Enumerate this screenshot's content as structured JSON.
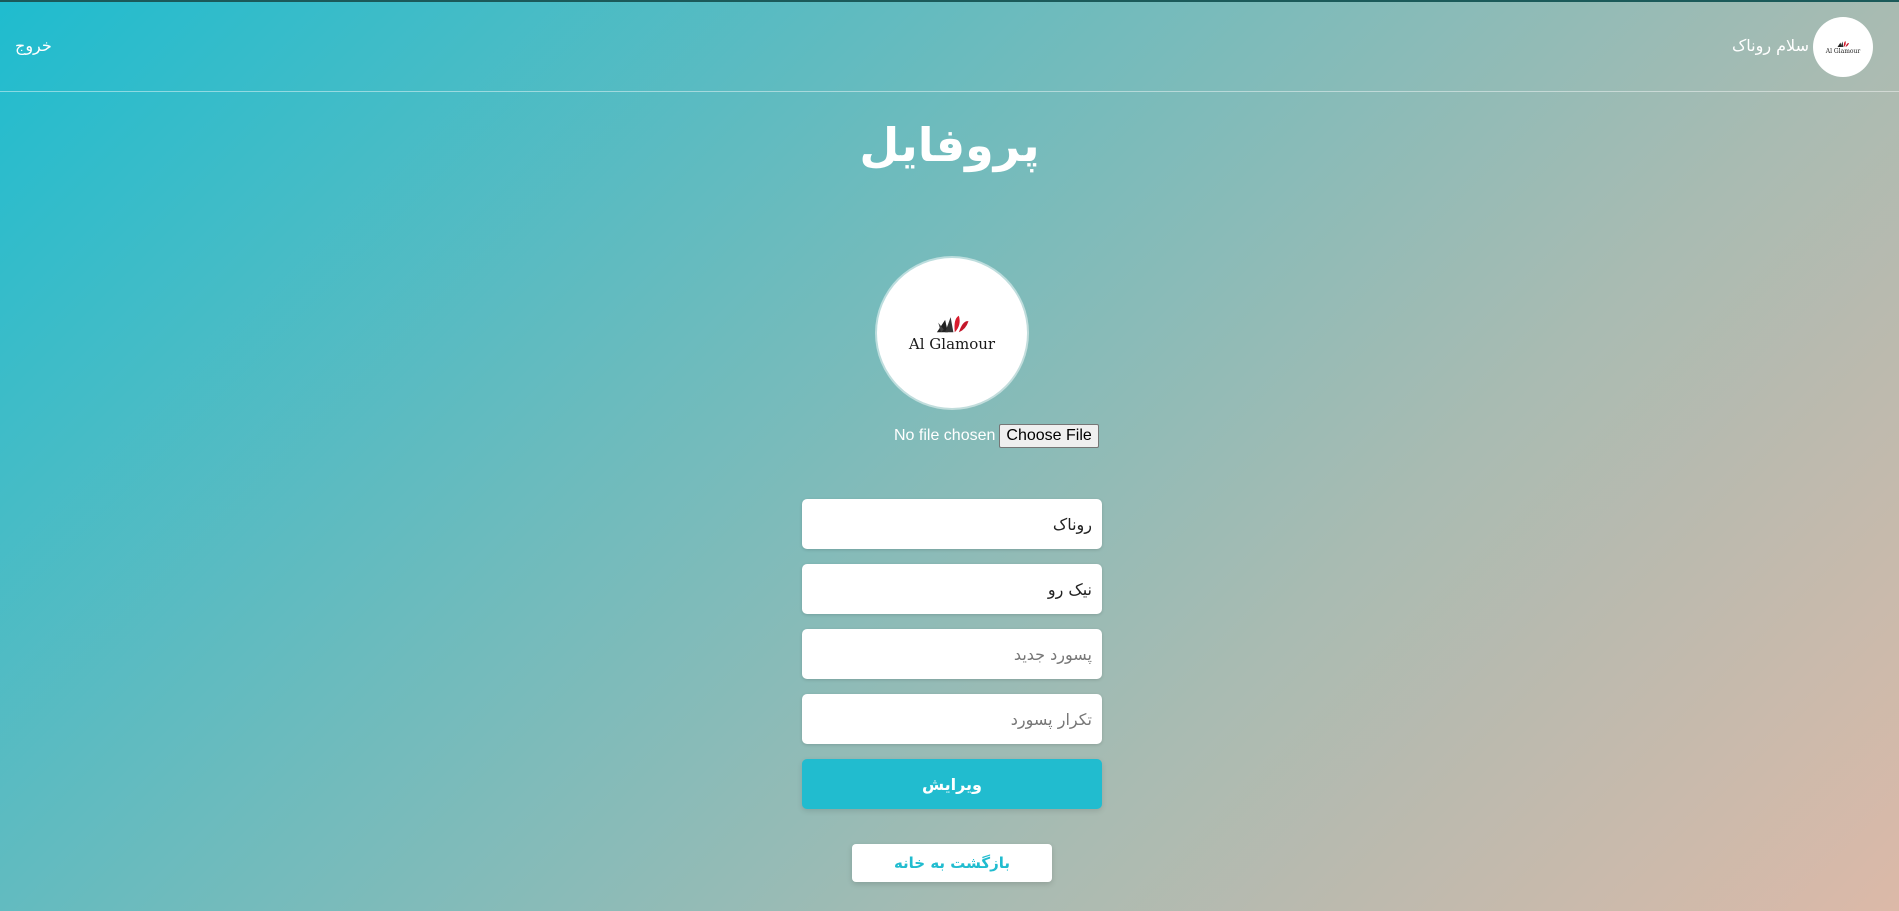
{
  "header": {
    "logout_label": "خروج",
    "greeting": "سلام روناک",
    "avatar_logo_text": "Al Glamour"
  },
  "page": {
    "title": "پروفایل"
  },
  "profile": {
    "avatar_logo_text": "Al Glamour",
    "file_status": "No file chosen",
    "file_button_label": "Choose File"
  },
  "form": {
    "first_name_value": "روناک",
    "last_name_value": "نیک رو",
    "new_password_placeholder": "پسورد جدید",
    "repeat_password_placeholder": "تکرار پسورد",
    "submit_label": "ویرایش"
  },
  "actions": {
    "home_label": "بازگشت به خانه"
  },
  "colors": {
    "accent": "#21bccf",
    "gradient_start": "#1fbccf",
    "gradient_end": "#dcb9a8"
  }
}
